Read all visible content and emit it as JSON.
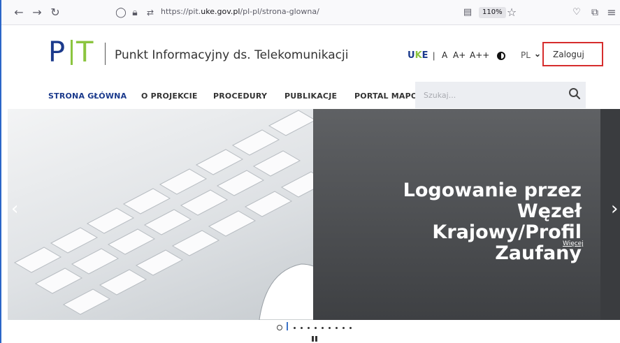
{
  "browser": {
    "url_prefix": "https://pit.",
    "url_domain": "uke.gov.pl",
    "url_path": "/pl-pl/strona-glowna/",
    "zoom": "110%"
  },
  "header": {
    "logo_p": "P",
    "logo_t": "T",
    "site_title": "Punkt Informacyjny ds. Telekomunikacji",
    "uke_u": "U",
    "uke_k": "K",
    "uke_e": "E",
    "separator": "|",
    "font_small": "A",
    "font_medium": "A+",
    "font_large": "A++",
    "lang": "PL",
    "login": "Zaloguj"
  },
  "nav": {
    "items": [
      "STRONA GŁÓWNA",
      "O PROJEKCIE",
      "PROCEDURY",
      "PUBLIKACJE",
      "PORTAL MAPOV"
    ],
    "search_placeholder": "Szukaj..."
  },
  "hero": {
    "title_line1": "Logowanie przez Węzeł",
    "title_line2": "Krajowy/Profil Zaufany",
    "more": "Więcej",
    "prev": "‹",
    "next": "›"
  },
  "colors": {
    "brand_blue": "#1b3a8c",
    "brand_green": "#8bc53f",
    "login_highlight": "#d62d2d"
  }
}
